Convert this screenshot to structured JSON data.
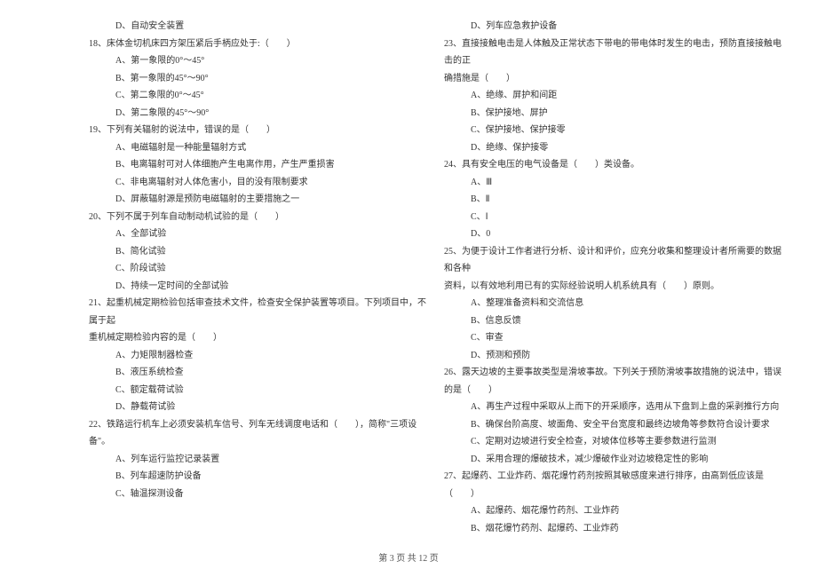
{
  "left": {
    "opt_d_17": "D、自动安全装置",
    "q18": "18、床体金切机床四方架压紧后手柄应处于:（　　）",
    "q18_a": "A、第一象限的0°～45°",
    "q18_b": "B、第一象限的45°～90°",
    "q18_c": "C、第二象限的0°～45°",
    "q18_d": "D、第二象限的45°～90°",
    "q19": "19、下列有关辐射的说法中，错误的是（　　）",
    "q19_a": "A、电磁辐射是一种能量辐射方式",
    "q19_b": "B、电离辐射可对人体细胞产生电离作用，产生严重损害",
    "q19_c": "C、非电离辐射对人体危害小，目的没有限制要求",
    "q19_d": "D、屏蔽辐射源是预防电磁辐射的主要措施之一",
    "q20": "20、下列不属于列车自动制动机试验的是（　　）",
    "q20_a": "A、全部试验",
    "q20_b": "B、简化试验",
    "q20_c": "C、阶段试验",
    "q20_d": "D、持续一定时间的全部试验",
    "q21": "21、起重机械定期检验包括审查技术文件，检查安全保护装置等项目。下列项目中，不属于起",
    "q21_cont": "重机械定期检验内容的是（　　）",
    "q21_a": "A、力矩限制器检查",
    "q21_b": "B、液压系统检查",
    "q21_c": "C、额定载荷试验",
    "q21_d": "D、静载荷试验",
    "q22": "22、铁路运行机车上必须安装机车信号、列车无线调度电话和（　　），简称\"三项设备\"。",
    "q22_a": "A、列车运行监控记录装置",
    "q22_b": "B、列车超速防护设备",
    "q22_c": "C、轴温探测设备"
  },
  "right": {
    "opt_d_22": "D、列车应急救护设备",
    "q23": "23、直接接触电击是人体触及正常状态下带电的带电体时发生的电击，预防直接接触电击的正",
    "q23_cont": "确措施是（　　）",
    "q23_a": "A、绝缘、屏护和间距",
    "q23_b": "B、保护接地、屏护",
    "q23_c": "C、保护接地、保护接零",
    "q23_d": "D、绝缘、保护接零",
    "q24": "24、具有安全电压的电气设备是（　　）类设备。",
    "q24_a": "A、Ⅲ",
    "q24_b": "B、Ⅱ",
    "q24_c": "C、Ⅰ",
    "q24_d": "D、0",
    "q25": "25、为便于设计工作者进行分析、设计和评价，应充分收集和整理设计者所需要的数据和各种",
    "q25_cont": "资料，以有效地利用已有的实际经验说明人机系统具有（　　）原则。",
    "q25_a": "A、整理准备资料和交流信息",
    "q25_b": "B、信息反馈",
    "q25_c": "C、审查",
    "q25_d": "D、预测和预防",
    "q26": "26、露天边坡的主要事故类型是滑坡事故。下列关于预防滑坡事故措施的说法中，错误的是（　　）",
    "q26_a": "A、再生产过程中采取从上而下的开采顺序，选用从下盘到上盘的采剥推行方向",
    "q26_b": "B、确保台阶高度、坡面角、安全平台宽度和最终边坡角等参数符合设计要求",
    "q26_c": "C、定期对边坡进行安全检查，对坡体位移等主要参数进行监测",
    "q26_d": "D、采用合理的爆破技术，减少爆破作业对边坡稳定性的影响",
    "q27": "27、起爆药、工业炸药、烟花爆竹药剂按照其敏感度来进行排序，由高到低应该是（　　）",
    "q27_a": "A、起爆药、烟花爆竹药剂、工业炸药",
    "q27_b": "B、烟花爆竹药剂、起爆药、工业炸药"
  },
  "footer": "第 3 页 共 12 页"
}
